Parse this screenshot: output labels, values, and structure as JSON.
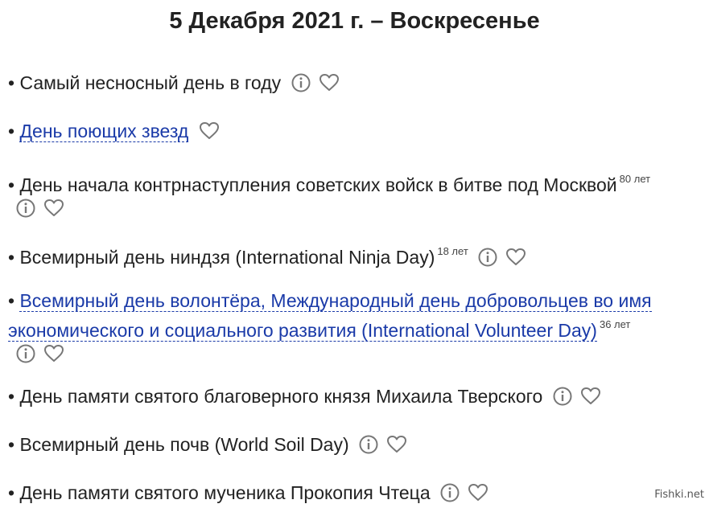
{
  "page": {
    "title": "5 Декабря 2021 г. – Воскресенье"
  },
  "holidays": [
    {
      "bullet": "•",
      "text": "Самый несносный день в году",
      "link": false,
      "years": "",
      "info": true
    },
    {
      "bullet": "•",
      "text": "День поющих звезд",
      "link": true,
      "years": "",
      "info": false
    },
    {
      "bullet": "•",
      "text": "День начала контрнаступления советских войск в битве под Москвой",
      "link": false,
      "years": "80 лет",
      "info": true
    },
    {
      "bullet": "•",
      "text": "Всемирный день ниндзя (International Ninja Day)",
      "link": false,
      "years": "18 лет",
      "info": true
    },
    {
      "bullet": "•",
      "text": "Всемирный день волонтёра, Международный день добровольцев во имя экономического и социального развития (International Volunteer Day)",
      "link": true,
      "years": "36 лет",
      "info": true
    },
    {
      "bullet": "•",
      "text": "День памяти святого благоверного князя Михаила Тверского",
      "link": false,
      "years": "",
      "info": true
    },
    {
      "bullet": "•",
      "text": "Всемирный день почв (World Soil Day)",
      "link": false,
      "years": "",
      "info": true
    },
    {
      "bullet": "•",
      "text": "День памяти святого мученика Прокопия Чтеца",
      "link": false,
      "years": "",
      "info": true
    }
  ],
  "icons": {
    "info": "info-icon",
    "favorite": "heart-icon"
  },
  "colors": {
    "link": "#1a3aa8",
    "text": "#222222",
    "icon": "#777777"
  },
  "watermark": "Fishki.net"
}
